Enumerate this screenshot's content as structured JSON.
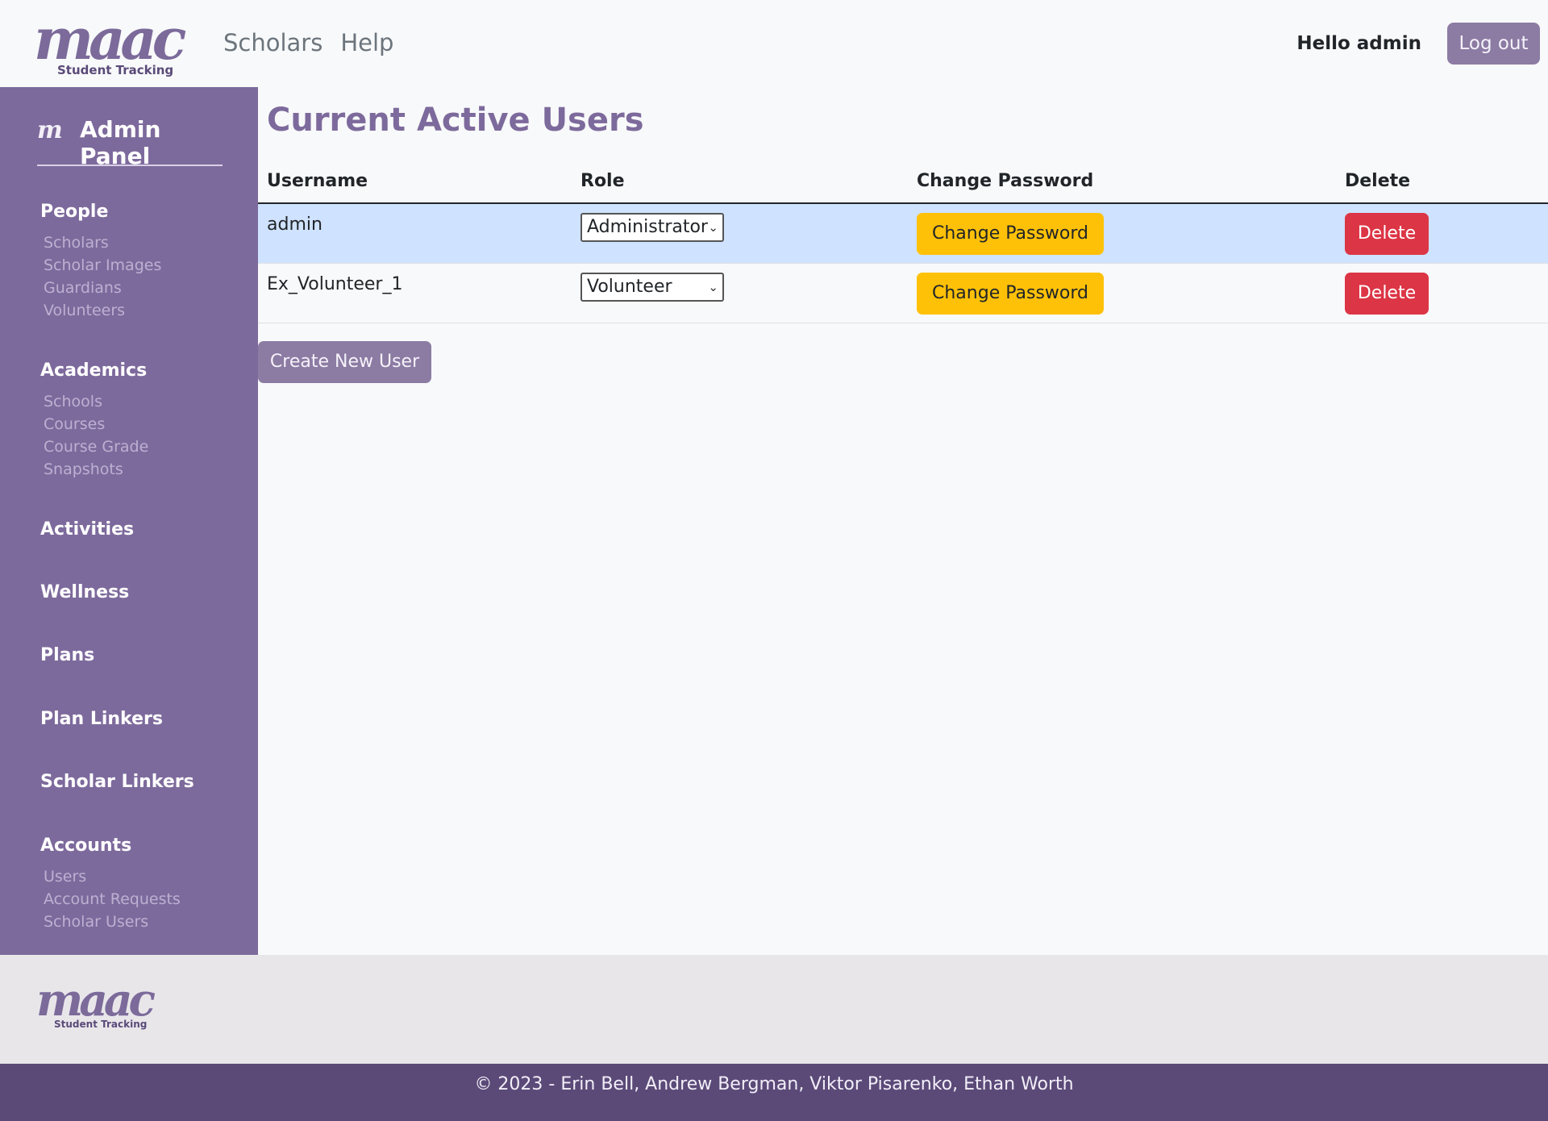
{
  "header": {
    "brand_wordmark": "maac",
    "brand_tagline": "Student Tracking",
    "nav": [
      "Scholars",
      "Help"
    ],
    "greeting": "Hello admin",
    "logout_label": "Log out"
  },
  "sidebar": {
    "title": "Admin Panel",
    "icon_glyph": "m",
    "sections": [
      {
        "title": "People",
        "links": [
          "Scholars",
          "Scholar Images",
          "Guardians",
          "Volunteers"
        ]
      },
      {
        "title": "Academics",
        "links": [
          "Schools",
          "Courses",
          "Course Grade",
          "Snapshots"
        ]
      },
      {
        "title": "Activities",
        "links": []
      },
      {
        "title": "Wellness",
        "links": []
      },
      {
        "title": "Plans",
        "links": []
      },
      {
        "title": "Plan Linkers",
        "links": []
      },
      {
        "title": "Scholar Linkers",
        "links": []
      },
      {
        "title": "Accounts",
        "links": [
          "Users",
          "Account Requests",
          "Scholar Users"
        ]
      }
    ]
  },
  "main": {
    "title": "Current Active Users",
    "columns": [
      "Username",
      "Role",
      "Change Password",
      "Delete"
    ],
    "rows": [
      {
        "username": "admin",
        "role": "Administrator",
        "change_label": "Change Password",
        "delete_label": "Delete",
        "active": true
      },
      {
        "username": "Ex_Volunteer_1",
        "role": "Volunteer",
        "change_label": "Change Password",
        "delete_label": "Delete",
        "active": false
      }
    ],
    "create_label": "Create New User"
  },
  "footer": {
    "brand_wordmark": "maac",
    "brand_tagline": "Student Tracking",
    "copyright": "© 2023 - Erin Bell, Andrew Bergman, Viktor Pisarenko, Ethan Worth"
  },
  "colors": {
    "sidebar": "#7d6a9c",
    "accent": "#8c7ba3",
    "warning": "#ffc107",
    "danger": "#dc3545",
    "active_row": "#cfe2ff",
    "footer_bar": "#5b4a78"
  }
}
